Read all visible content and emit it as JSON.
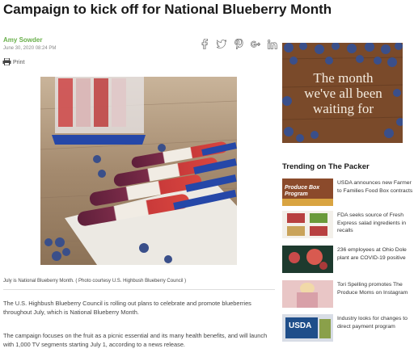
{
  "article": {
    "headline": "Campaign to kick off for National Blueberry Month",
    "author": "Amy Sowder",
    "date": "June 30, 2020 08:24 PM",
    "print_label": "Print",
    "social_icons": [
      "facebook-icon",
      "twitter-icon",
      "pinterest-icon",
      "google-plus-icon",
      "linkedin-icon"
    ],
    "caption": "July is National Blueberry Month. ( Photo courtesy U.S. Highbush Blueberry Council )",
    "paragraphs": [
      "The U.S. Highbush Blueberry Council is rolling out plans to celebrate and promote blueberries throughout July, which is National Blueberry Month.",
      "The campaign focuses on the fruit as a picnic essential and its many health benefits, and will launch with 1,000 TV segments starting July 1, according to a news release."
    ]
  },
  "sidebar": {
    "ad_text": "The month we've all been waiting for",
    "trending_title": "Trending on The Packer",
    "trending": [
      {
        "title": "USDA announces new Farmer to Families Food Box contracts",
        "thumb_text": "Produce Box Program"
      },
      {
        "title": "FDA seeks source of Fresh Express salad ingredients in recalls",
        "thumb_text": ""
      },
      {
        "title": "236 employees at Ohio Dole plant are COVID-19 positive",
        "thumb_text": ""
      },
      {
        "title": "Tori Spelling promotes The Produce Moms on Instagram",
        "thumb_text": ""
      },
      {
        "title": "Industry looks for changes to direct payment program",
        "thumb_text": "USDA"
      }
    ]
  },
  "colors": {
    "author_green": "#6ab04c",
    "ad_wood": "#7a4a2a",
    "blueberry": "#3a4f8a"
  }
}
